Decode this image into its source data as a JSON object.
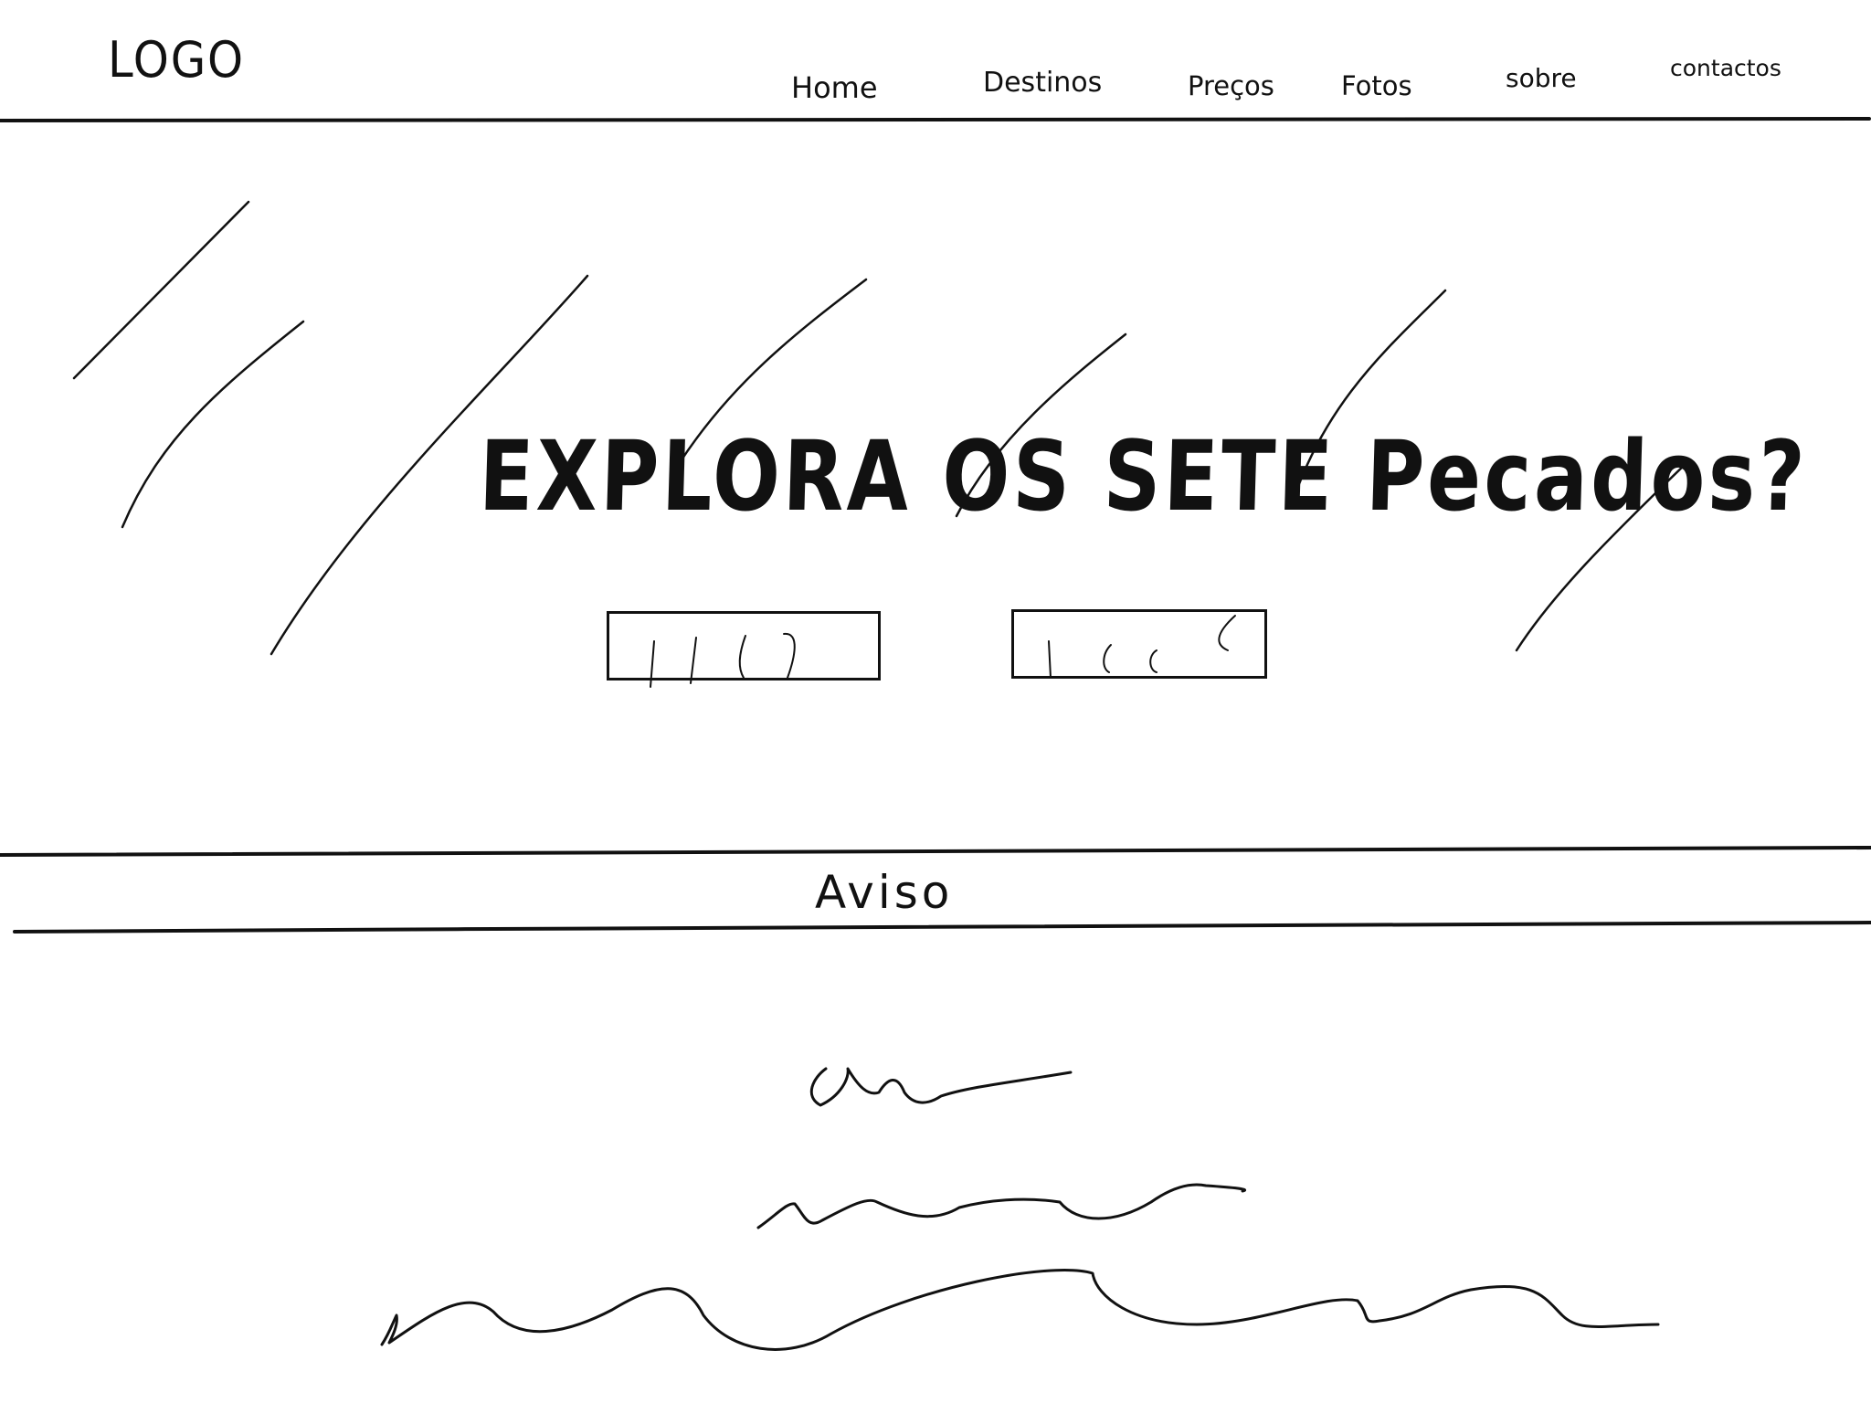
{
  "header": {
    "logo": "LOGO",
    "nav": [
      {
        "label": "Home"
      },
      {
        "label": "Destinos"
      },
      {
        "label": "Preços"
      },
      {
        "label": "Fotos"
      },
      {
        "label": "sobre"
      },
      {
        "label": "contactos"
      }
    ]
  },
  "hero": {
    "title": "EXPLORA OS SETE Pecados?"
  },
  "notice": {
    "label": "Aviso"
  }
}
